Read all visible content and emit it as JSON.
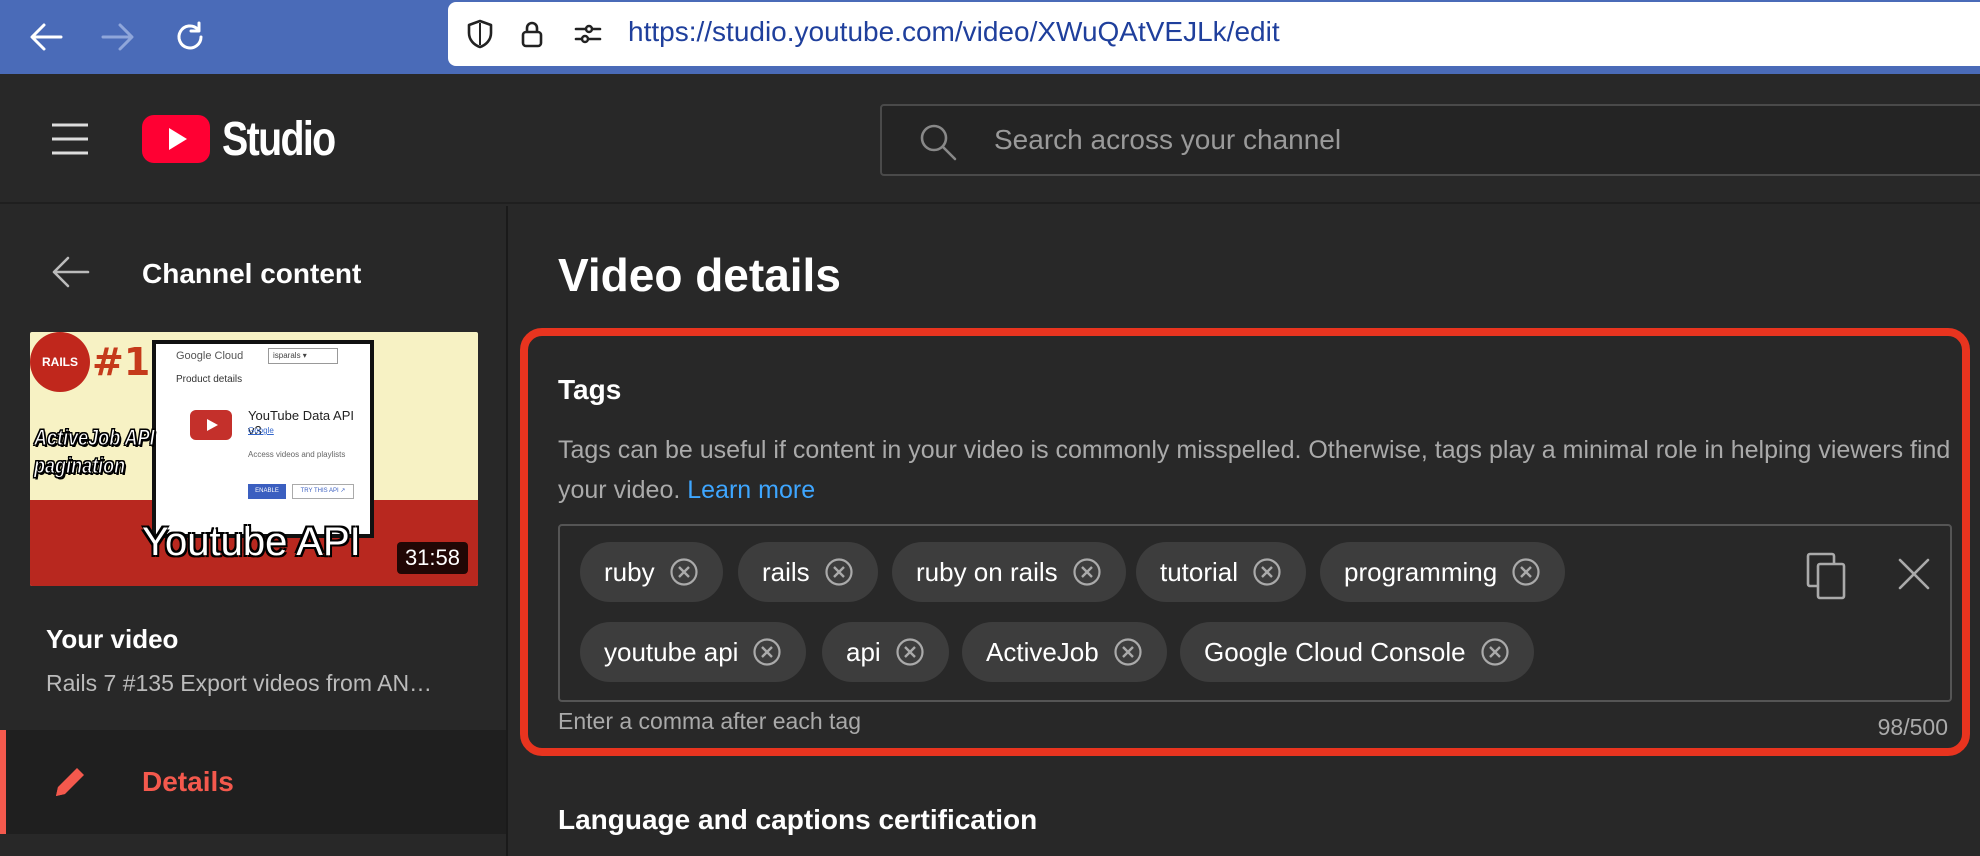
{
  "browser": {
    "url": "https://studio.youtube.com/video/XWuQAtVEJLk/edit"
  },
  "header": {
    "logo_text": "Studio",
    "search_placeholder": "Search across your channel"
  },
  "sidebar": {
    "back_label": "Channel content",
    "thumbnail": {
      "badge": "RAILS",
      "episode": "#135",
      "card_brand": "Google Cloud",
      "card_project": "isparals ▾",
      "card_section": "Product details",
      "card_title": "YouTube Data API v3",
      "card_vendor": "Google",
      "card_desc": "Access videos and playlists",
      "card_enable": "ENABLE",
      "card_try": "TRY THIS API ↗",
      "overlay_text": "ActiveJob API pagination",
      "caption": "Youtube API",
      "duration": "31:58"
    },
    "your_video_label": "Your video",
    "video_title": "Rails 7 #135 Export videos from AN…",
    "active_item": "Details"
  },
  "main": {
    "page_title": "Video details",
    "tags": {
      "heading": "Tags",
      "description": "Tags can be useful if content in your video is commonly misspelled. Otherwise, tags play a minimal role in helping viewers find your video.",
      "learn_more": "Learn more",
      "items": [
        "ruby",
        "rails",
        "ruby on rails",
        "tutorial",
        "programming",
        "youtube api",
        "api",
        "ActiveJob",
        "Google Cloud Console"
      ],
      "hint": "Enter a comma after each tag",
      "count": "98/500"
    },
    "next_section_heading": "Language and captions certification"
  },
  "colors": {
    "accent": "#f4594d",
    "highlight_border": "#e8341f",
    "link": "#3ea6ff",
    "browser_bar": "#4a6bb8"
  }
}
